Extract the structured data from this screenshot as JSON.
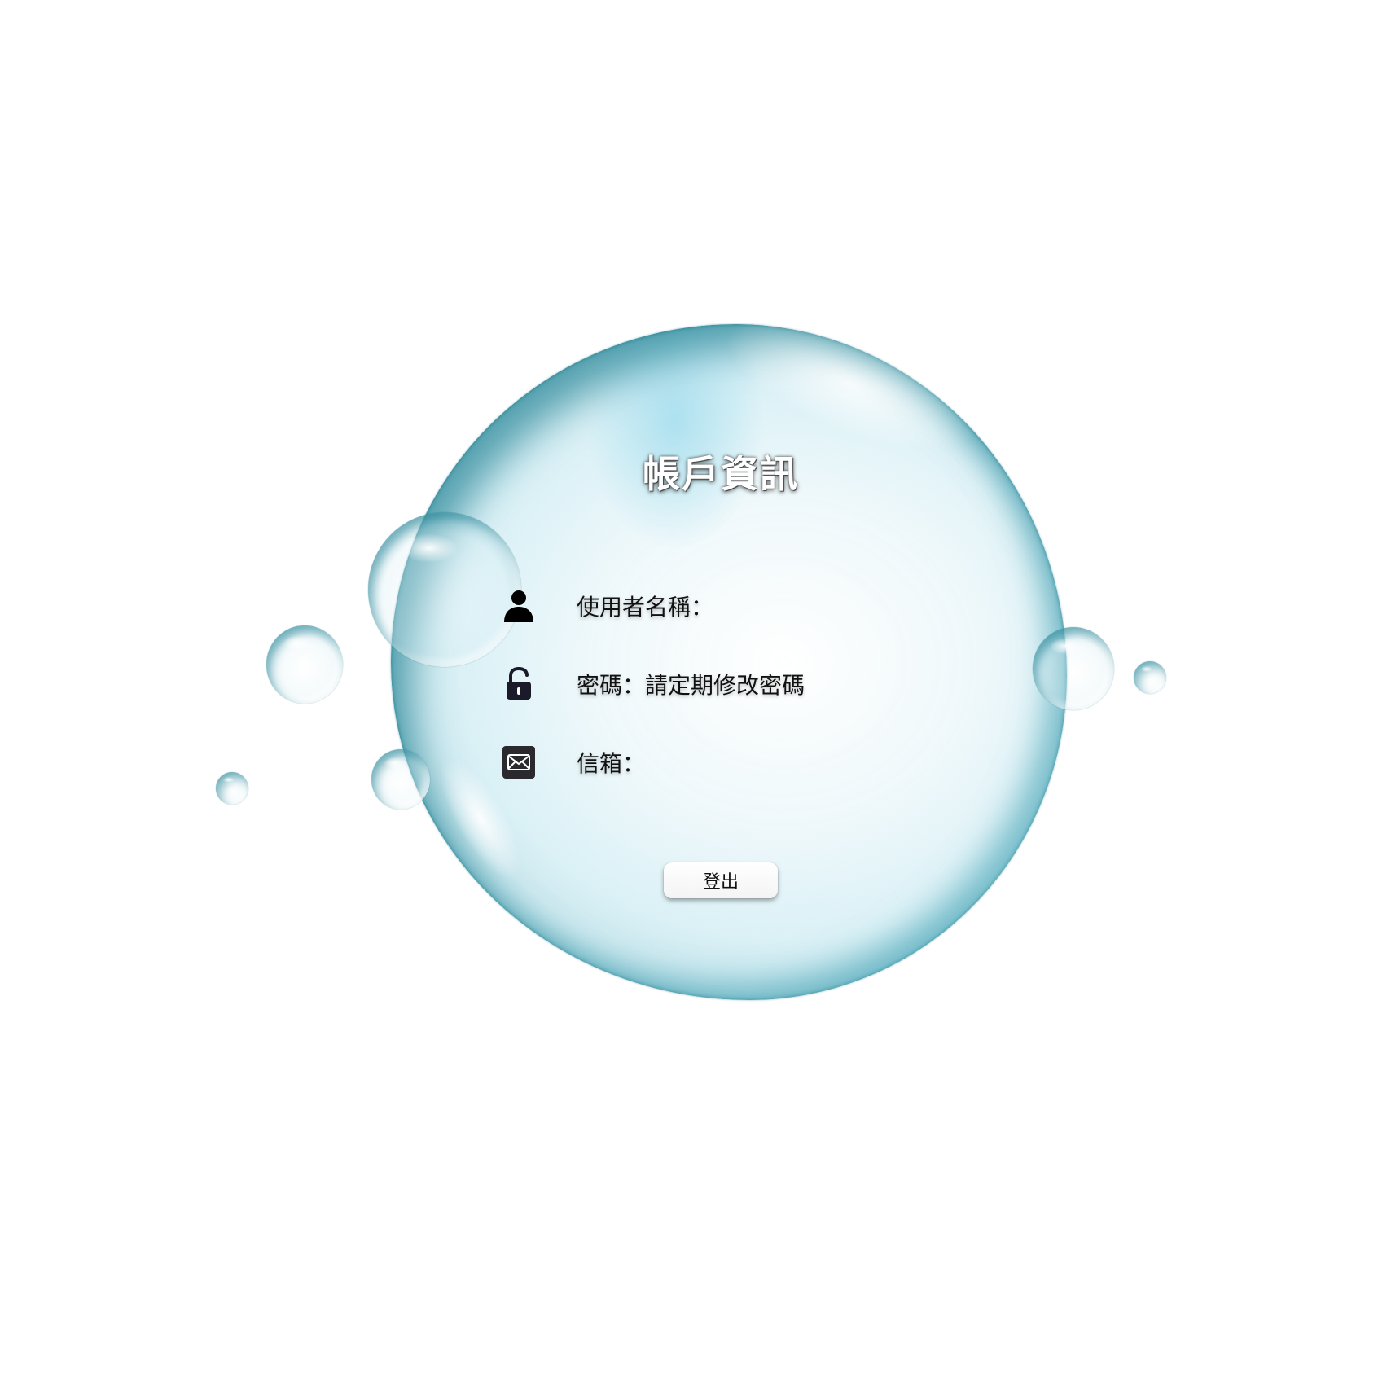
{
  "page": {
    "title": "帳戶資訊"
  },
  "account": {
    "username_label": "使用者名稱：",
    "password_label": "密碼：請定期修改密碼",
    "email_label": "信箱："
  },
  "icons": {
    "user": "user-icon",
    "lock": "lock-icon",
    "mail": "mail-icon"
  },
  "actions": {
    "logout_label": "登出"
  },
  "colors": {
    "bubble_teal": "#1e8ca0",
    "text": "#111111",
    "title_text": "#ffffff"
  }
}
